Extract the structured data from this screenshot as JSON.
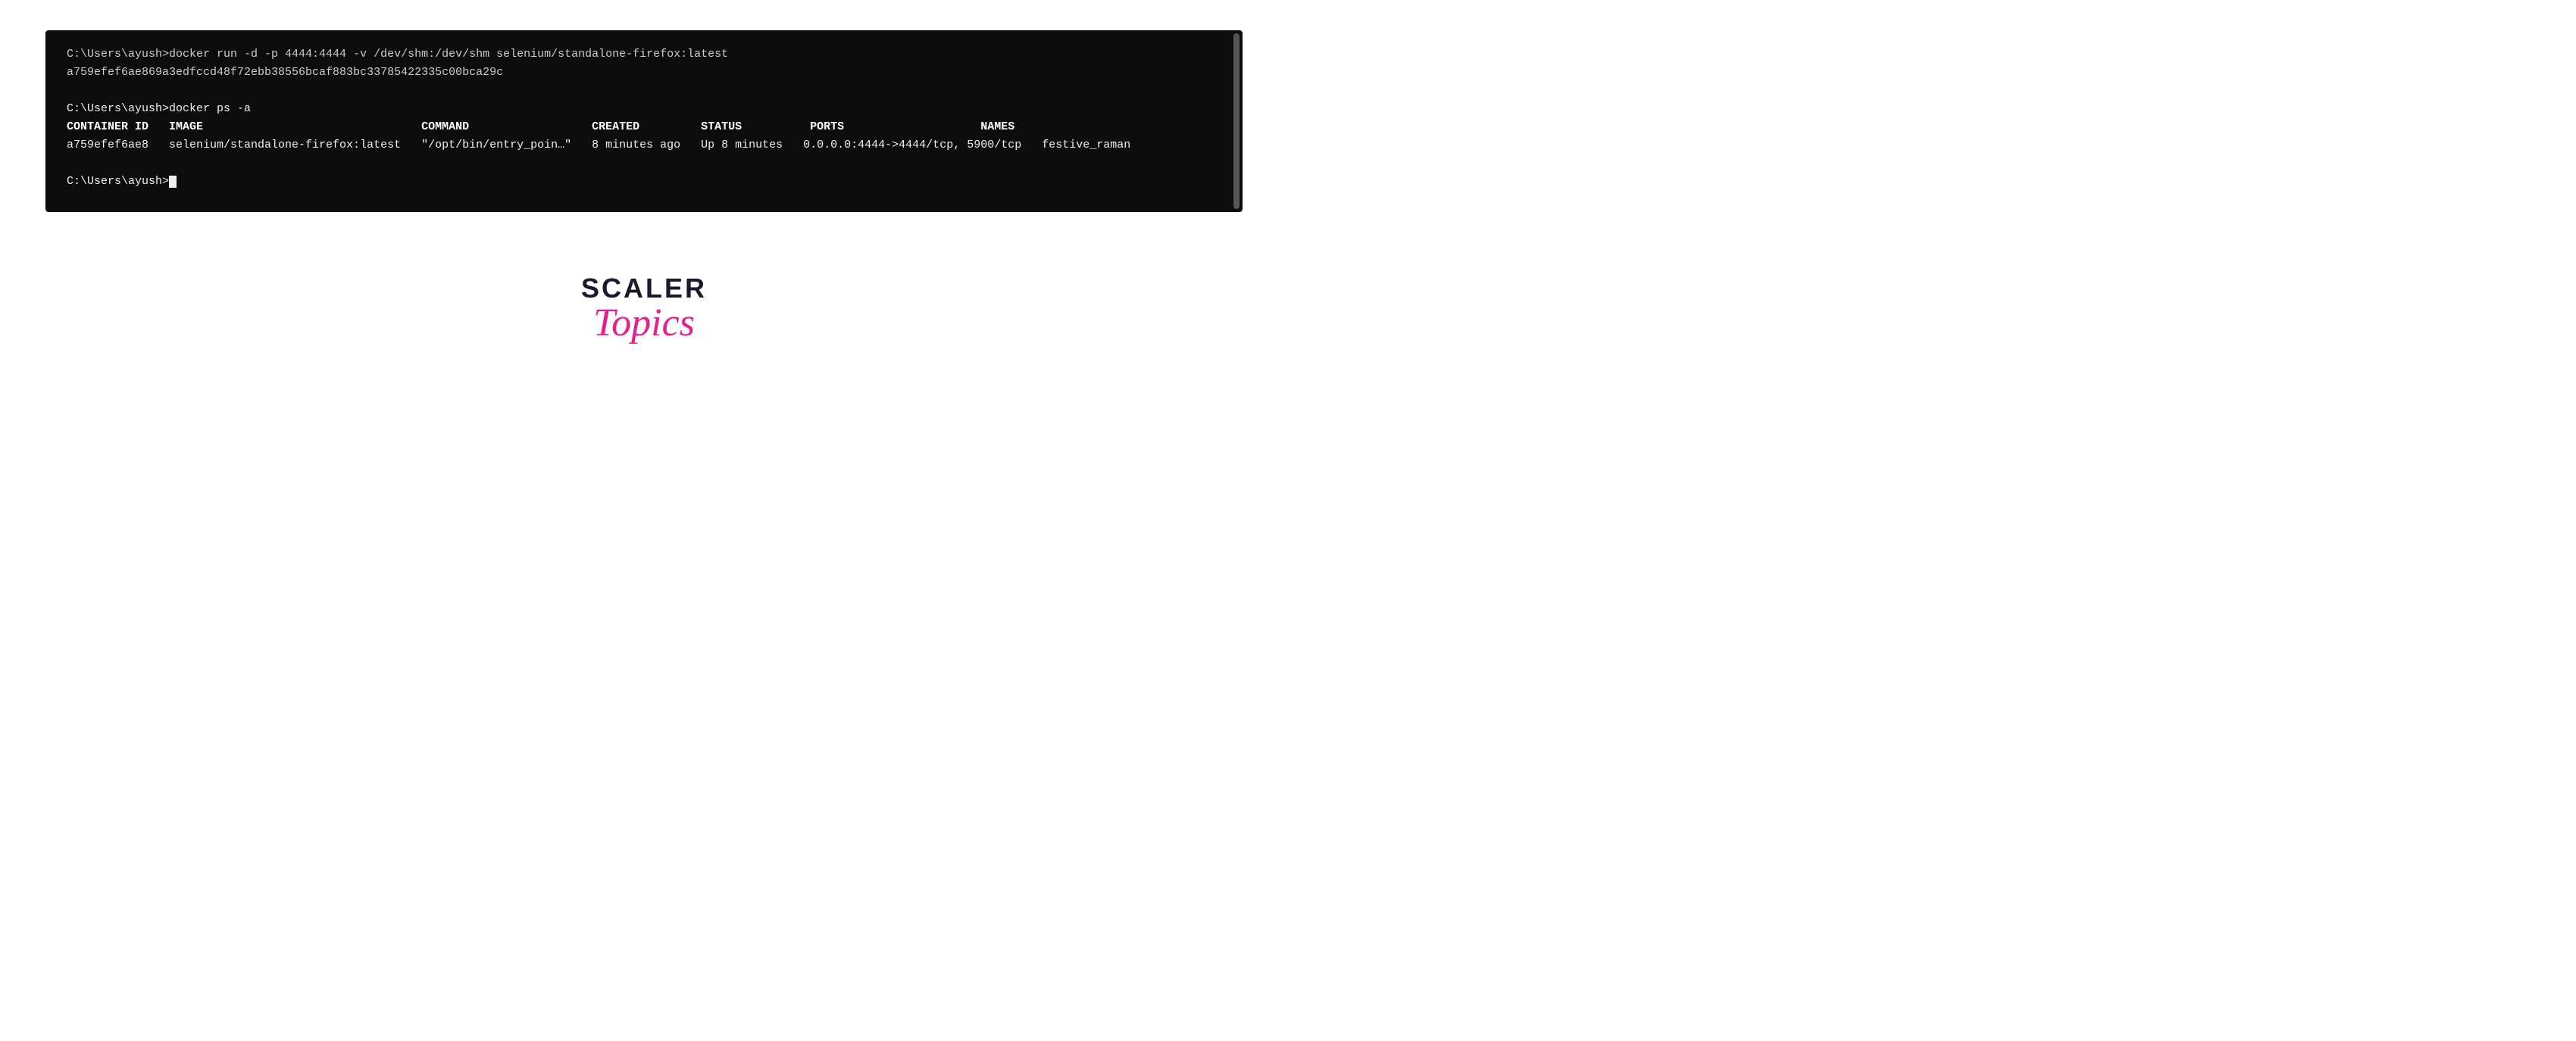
{
  "terminal": {
    "lines": [
      {
        "id": "line1",
        "text": "C:\\Users\\ayush>docker run -d -p 4444:4444 -v /dev/shm:/dev/shm selenium/standalone-firefox:latest",
        "type": "dim"
      },
      {
        "id": "line2",
        "text": "a759efef6ae869a3edfccd48f72ebb38556bcaf883bc33785422335c00bca29c",
        "type": "dim"
      },
      {
        "id": "line3",
        "text": "",
        "type": "normal"
      },
      {
        "id": "line4",
        "text": "C:\\Users\\ayush>docker ps -a",
        "type": "normal"
      },
      {
        "id": "line5",
        "text": "CONTAINER ID   IMAGE                                COMMAND                  CREATED         STATUS          PORTS                    NAMES",
        "type": "header"
      },
      {
        "id": "line6",
        "text": "a759efef6ae8   selenium/standalone-firefox:latest   \"/opt/bin/entry_poin…\"   8 minutes ago   Up 8 minutes   0.0.0.0:4444->4444/tcp, 5900/tcp   festive_raman",
        "type": "normal"
      },
      {
        "id": "line7",
        "text": "",
        "type": "normal"
      },
      {
        "id": "line8",
        "text": "C:\\Users\\ayush>",
        "type": "cursor"
      }
    ]
  },
  "logo": {
    "scaler_text": "SCALER",
    "topics_text": "Topics"
  }
}
